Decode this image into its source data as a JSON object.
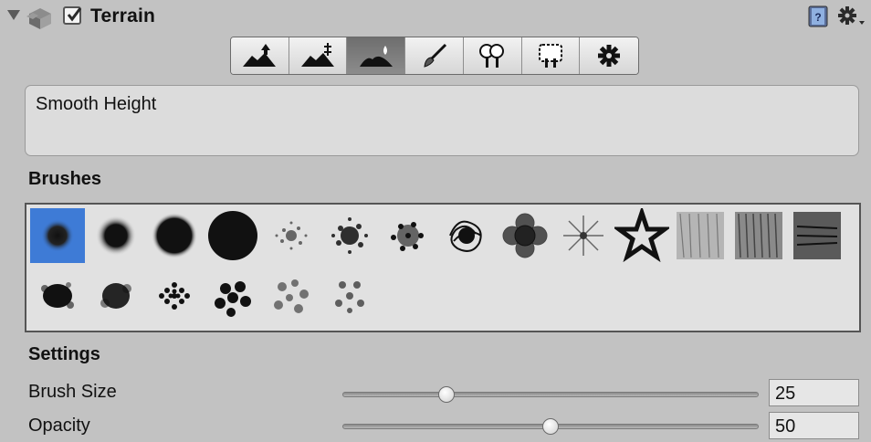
{
  "header": {
    "title": "Terrain",
    "enabled": true
  },
  "toolbar": {
    "tools": [
      {
        "name": "raise-lower-icon"
      },
      {
        "name": "paint-height-icon"
      },
      {
        "name": "smooth-height-icon",
        "active": true
      },
      {
        "name": "paint-texture-icon"
      },
      {
        "name": "place-trees-icon"
      },
      {
        "name": "paint-details-icon"
      },
      {
        "name": "terrain-settings-icon"
      }
    ]
  },
  "description": {
    "text": "Smooth Height"
  },
  "brushes": {
    "label": "Brushes",
    "items": [
      {
        "name": "brush-soft-small",
        "selected": true
      },
      {
        "name": "brush-soft-medium"
      },
      {
        "name": "brush-soft-large"
      },
      {
        "name": "brush-hard-circle"
      },
      {
        "name": "brush-noise-sparse"
      },
      {
        "name": "brush-noise-dense"
      },
      {
        "name": "brush-noise-speckle"
      },
      {
        "name": "brush-scribble"
      },
      {
        "name": "brush-flower"
      },
      {
        "name": "brush-star-burst"
      },
      {
        "name": "brush-star"
      },
      {
        "name": "brush-texture-light"
      },
      {
        "name": "brush-texture-medium"
      },
      {
        "name": "brush-texture-dark"
      },
      {
        "name": "brush-splat-1"
      },
      {
        "name": "brush-splat-2"
      },
      {
        "name": "brush-dots-fine"
      },
      {
        "name": "brush-dots-large"
      },
      {
        "name": "brush-cloud-1"
      },
      {
        "name": "brush-cloud-2"
      }
    ]
  },
  "settings": {
    "label": "Settings",
    "brush_size": {
      "label": "Brush Size",
      "value": "25",
      "fraction": 0.25
    },
    "opacity": {
      "label": "Opacity",
      "value": "50",
      "fraction": 0.5
    }
  },
  "colors": {
    "selection": "#3e7bd6",
    "panel": "#c2c2c2"
  }
}
